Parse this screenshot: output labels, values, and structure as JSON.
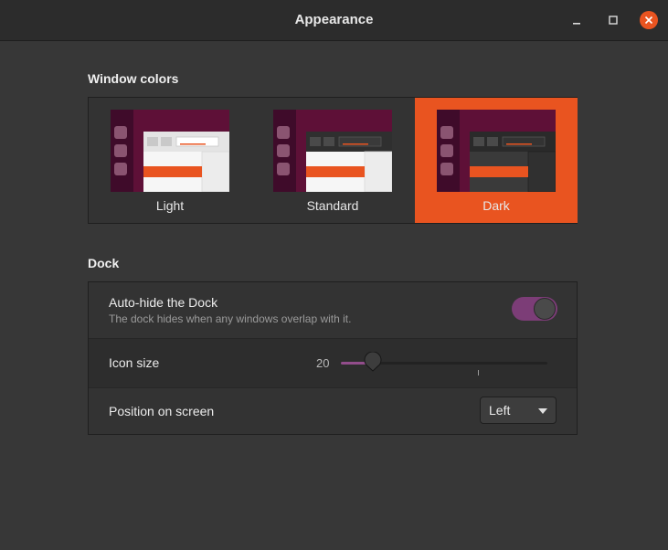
{
  "window": {
    "title": "Appearance"
  },
  "window_colors": {
    "heading": "Window colors",
    "themes": [
      {
        "label": "Light",
        "selected": false
      },
      {
        "label": "Standard",
        "selected": false
      },
      {
        "label": "Dark",
        "selected": true
      }
    ],
    "accent_color": "#e95420"
  },
  "dock": {
    "heading": "Dock",
    "autohide": {
      "label": "Auto-hide the Dock",
      "description": "The dock hides when any windows overlap with it.",
      "enabled": true
    },
    "icon_size": {
      "label": "Icon size",
      "value": "20",
      "min": 16,
      "max": 64,
      "current": 20
    },
    "position": {
      "label": "Position on screen",
      "selected": "Left"
    }
  }
}
